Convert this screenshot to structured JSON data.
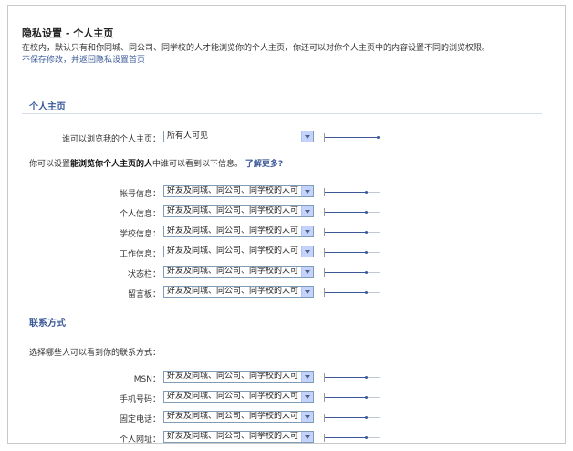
{
  "header": {
    "title": "隐私设置 - 个人主页",
    "intro": "在校内，默认只有和你同城、同公司、同学校的人才能浏览你的个人主页，你还可以对你个人主页中的内容设置不同的浏览权限。",
    "back_link": "不保存修改，并返回隐私设置首页"
  },
  "profile_section": {
    "title": "个人主页",
    "who_can_view_label": "谁可以浏览我的个人主页：",
    "who_can_view_value": "所有人可见",
    "note_prefix": "你可以设置",
    "note_bold": "能浏览你个人主页的人",
    "note_suffix": "中谁可以看到以下信息。",
    "learn_more": "了解更多?",
    "rows": [
      {
        "label": "帐号信息：",
        "value": "好友及同城、同公司、同学校的人可"
      },
      {
        "label": "个人信息：",
        "value": "好友及同城、同公司、同学校的人可"
      },
      {
        "label": "学校信息：",
        "value": "好友及同城、同公司、同学校的人可"
      },
      {
        "label": "工作信息：",
        "value": "好友及同城、同公司、同学校的人可"
      },
      {
        "label": "状态栏：",
        "value": "好友及同城、同公司、同学校的人可"
      },
      {
        "label": "留言板：",
        "value": "好友及同城、同公司、同学校的人可"
      }
    ]
  },
  "contact_section": {
    "title": "联系方式",
    "note": "选择哪些人可以看到你的联系方式：",
    "rows": [
      {
        "label": "MSN：",
        "value": "好友及同城、同公司、同学校的人可"
      },
      {
        "label": "手机号码：",
        "value": "好友及同城、同公司、同学校的人可"
      },
      {
        "label": "固定电话：",
        "value": "好友及同城、同公司、同学校的人可"
      },
      {
        "label": "个人网址：",
        "value": "好友及同城、同公司、同学校的人可"
      }
    ]
  },
  "colors": {
    "accent": "#3b5998",
    "rule": "#d8dfea"
  }
}
